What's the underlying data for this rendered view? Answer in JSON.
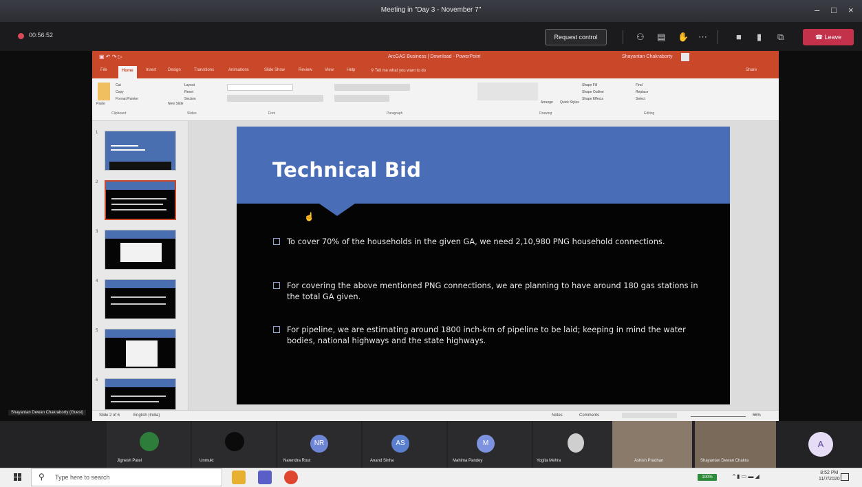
{
  "window": {
    "title": "Meeting in \"Day 3 - November 7\"",
    "controls": [
      "–",
      "□",
      "×"
    ]
  },
  "meeting": {
    "timer": "00:56:52",
    "request_control": "Request control",
    "leave": "Leave",
    "icons": [
      "people-icon",
      "chat-icon",
      "raise-hand-icon",
      "more-icon",
      "camera-icon",
      "mic-icon",
      "share-icon"
    ]
  },
  "ppt": {
    "title": "ArcGAS Business | Download - PowerPoint",
    "user": "Shayantan Chakraborty",
    "tabs": [
      "File",
      "Home",
      "Insert",
      "Design",
      "Transitions",
      "Animations",
      "Slide Show",
      "Review",
      "View",
      "Help",
      "Tell me what you want to do"
    ],
    "share": "Share",
    "ribbon_groups": [
      "Clipboard",
      "Slides",
      "Font",
      "Paragraph",
      "Drawing",
      "Editing"
    ],
    "ribbon_labels": {
      "cut": "Cut",
      "copy": "Copy",
      "format_painter": "Format Painter",
      "paste": "Paste",
      "new_slide": "New Slide",
      "layout": "Layout",
      "reset": "Reset",
      "section": "Section",
      "arrange": "Arrange",
      "quick_styles": "Quick Styles",
      "find": "Find",
      "replace": "Replace",
      "select": "Select",
      "shape_fill": "Shape Fill",
      "shape_outline": "Shape Outline",
      "shape_effects": "Shape Effects"
    },
    "slide_numbers": [
      "1",
      "2",
      "3",
      "4",
      "5",
      "6"
    ],
    "status": {
      "slide": "Slide 2 of 6",
      "lang": "English (India)",
      "notes": "Notes",
      "comments": "Comments",
      "zoom": "66%"
    }
  },
  "slide": {
    "title": "Technical Bid",
    "bullets": [
      "To cover 70% of the households in the given GA, we need 2,10,980 PNG household connections.",
      "For covering the above mentioned PNG connections, we are planning to have around 180 gas stations in the total GA given.",
      "For pipeline, we are estimating around 1800 inch-km of pipeline to be laid; keeping in mind the water bodies, national highways and the state highways."
    ]
  },
  "presenter_label": "Shayantan Dewan Chakraborty (Guest)",
  "participants": [
    {
      "name": "Jignesh Patel",
      "initials": "",
      "color": "#2f7d3a"
    },
    {
      "name": "Unmukt",
      "initials": "",
      "color": "#0b0b0b"
    },
    {
      "name": "Narendra Rout",
      "initials": "NR",
      "color": "#6f86d6"
    },
    {
      "name": "Anand Sinha",
      "initials": "AS",
      "color": "#5b7fcf"
    },
    {
      "name": "Mahima Pandey",
      "initials": "M",
      "color": "#7e93e0"
    },
    {
      "name": "Yogita Mehra",
      "initials": "",
      "color": "#cfcfcf"
    },
    {
      "name": "Ashish Pradhan",
      "initials": "",
      "color": "#8a7a6a"
    },
    {
      "name": "Shayantan Dewan Chakra",
      "initials": "",
      "color": "#7a6a5a"
    },
    {
      "name": "",
      "initials": "A",
      "color": "#e6dcf5"
    }
  ],
  "taskbar": {
    "search_placeholder": "Type here to search",
    "time": "8:52 PM",
    "date": "11/7/2020",
    "battery": "100%"
  }
}
